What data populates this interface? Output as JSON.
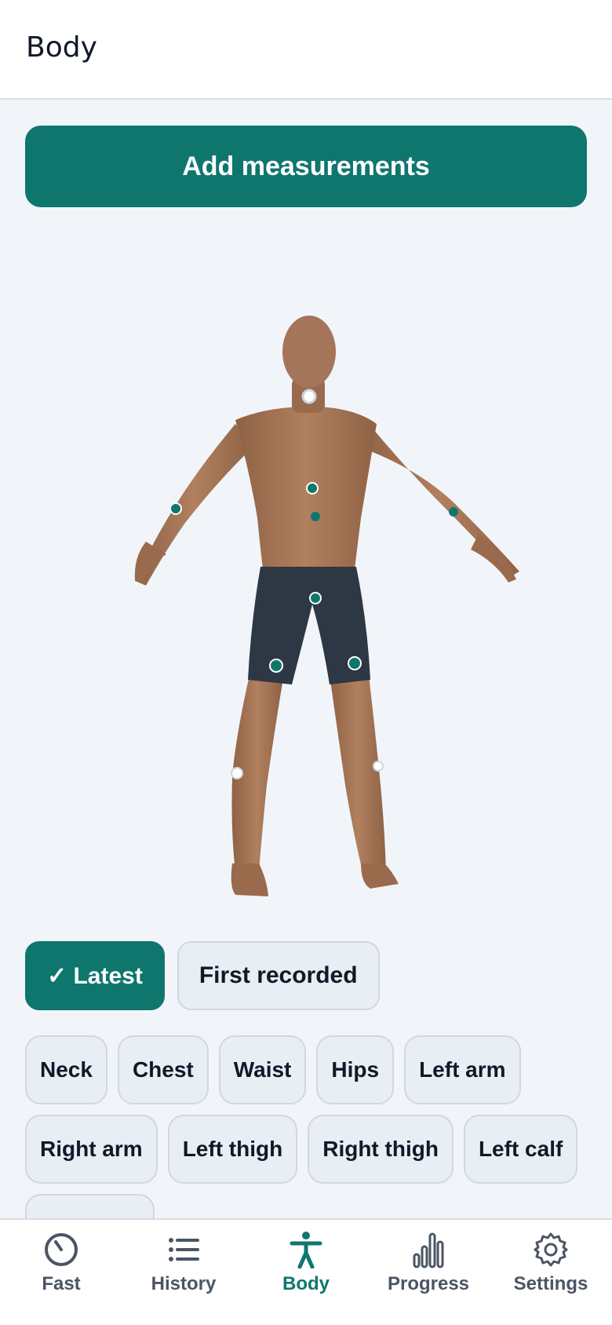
{
  "header": {
    "title": "Body"
  },
  "actions": {
    "add_label": "Add measurements"
  },
  "compare": {
    "latest_label": "✓ Latest",
    "first_label": "First recorded",
    "selected": "Latest"
  },
  "measurements": [
    {
      "label": "Neck"
    },
    {
      "label": "Chest"
    },
    {
      "label": "Waist"
    },
    {
      "label": "Hips"
    },
    {
      "label": "Left arm"
    },
    {
      "label": "Right arm"
    },
    {
      "label": "Left thigh"
    },
    {
      "label": "Right thigh"
    },
    {
      "label": "Left calf"
    },
    {
      "label": ""
    }
  ],
  "tabs": [
    {
      "label": "Fast",
      "icon": "gauge-icon"
    },
    {
      "label": "History",
      "icon": "list-icon"
    },
    {
      "label": "Body",
      "icon": "person-icon",
      "active": true
    },
    {
      "label": "Progress",
      "icon": "bar-chart-icon"
    },
    {
      "label": "Settings",
      "icon": "gear-icon"
    }
  ],
  "colors": {
    "accent": "#0f766e",
    "skin": "#a9785a",
    "shorts": "#2e3744",
    "background": "#f1f5f9"
  }
}
